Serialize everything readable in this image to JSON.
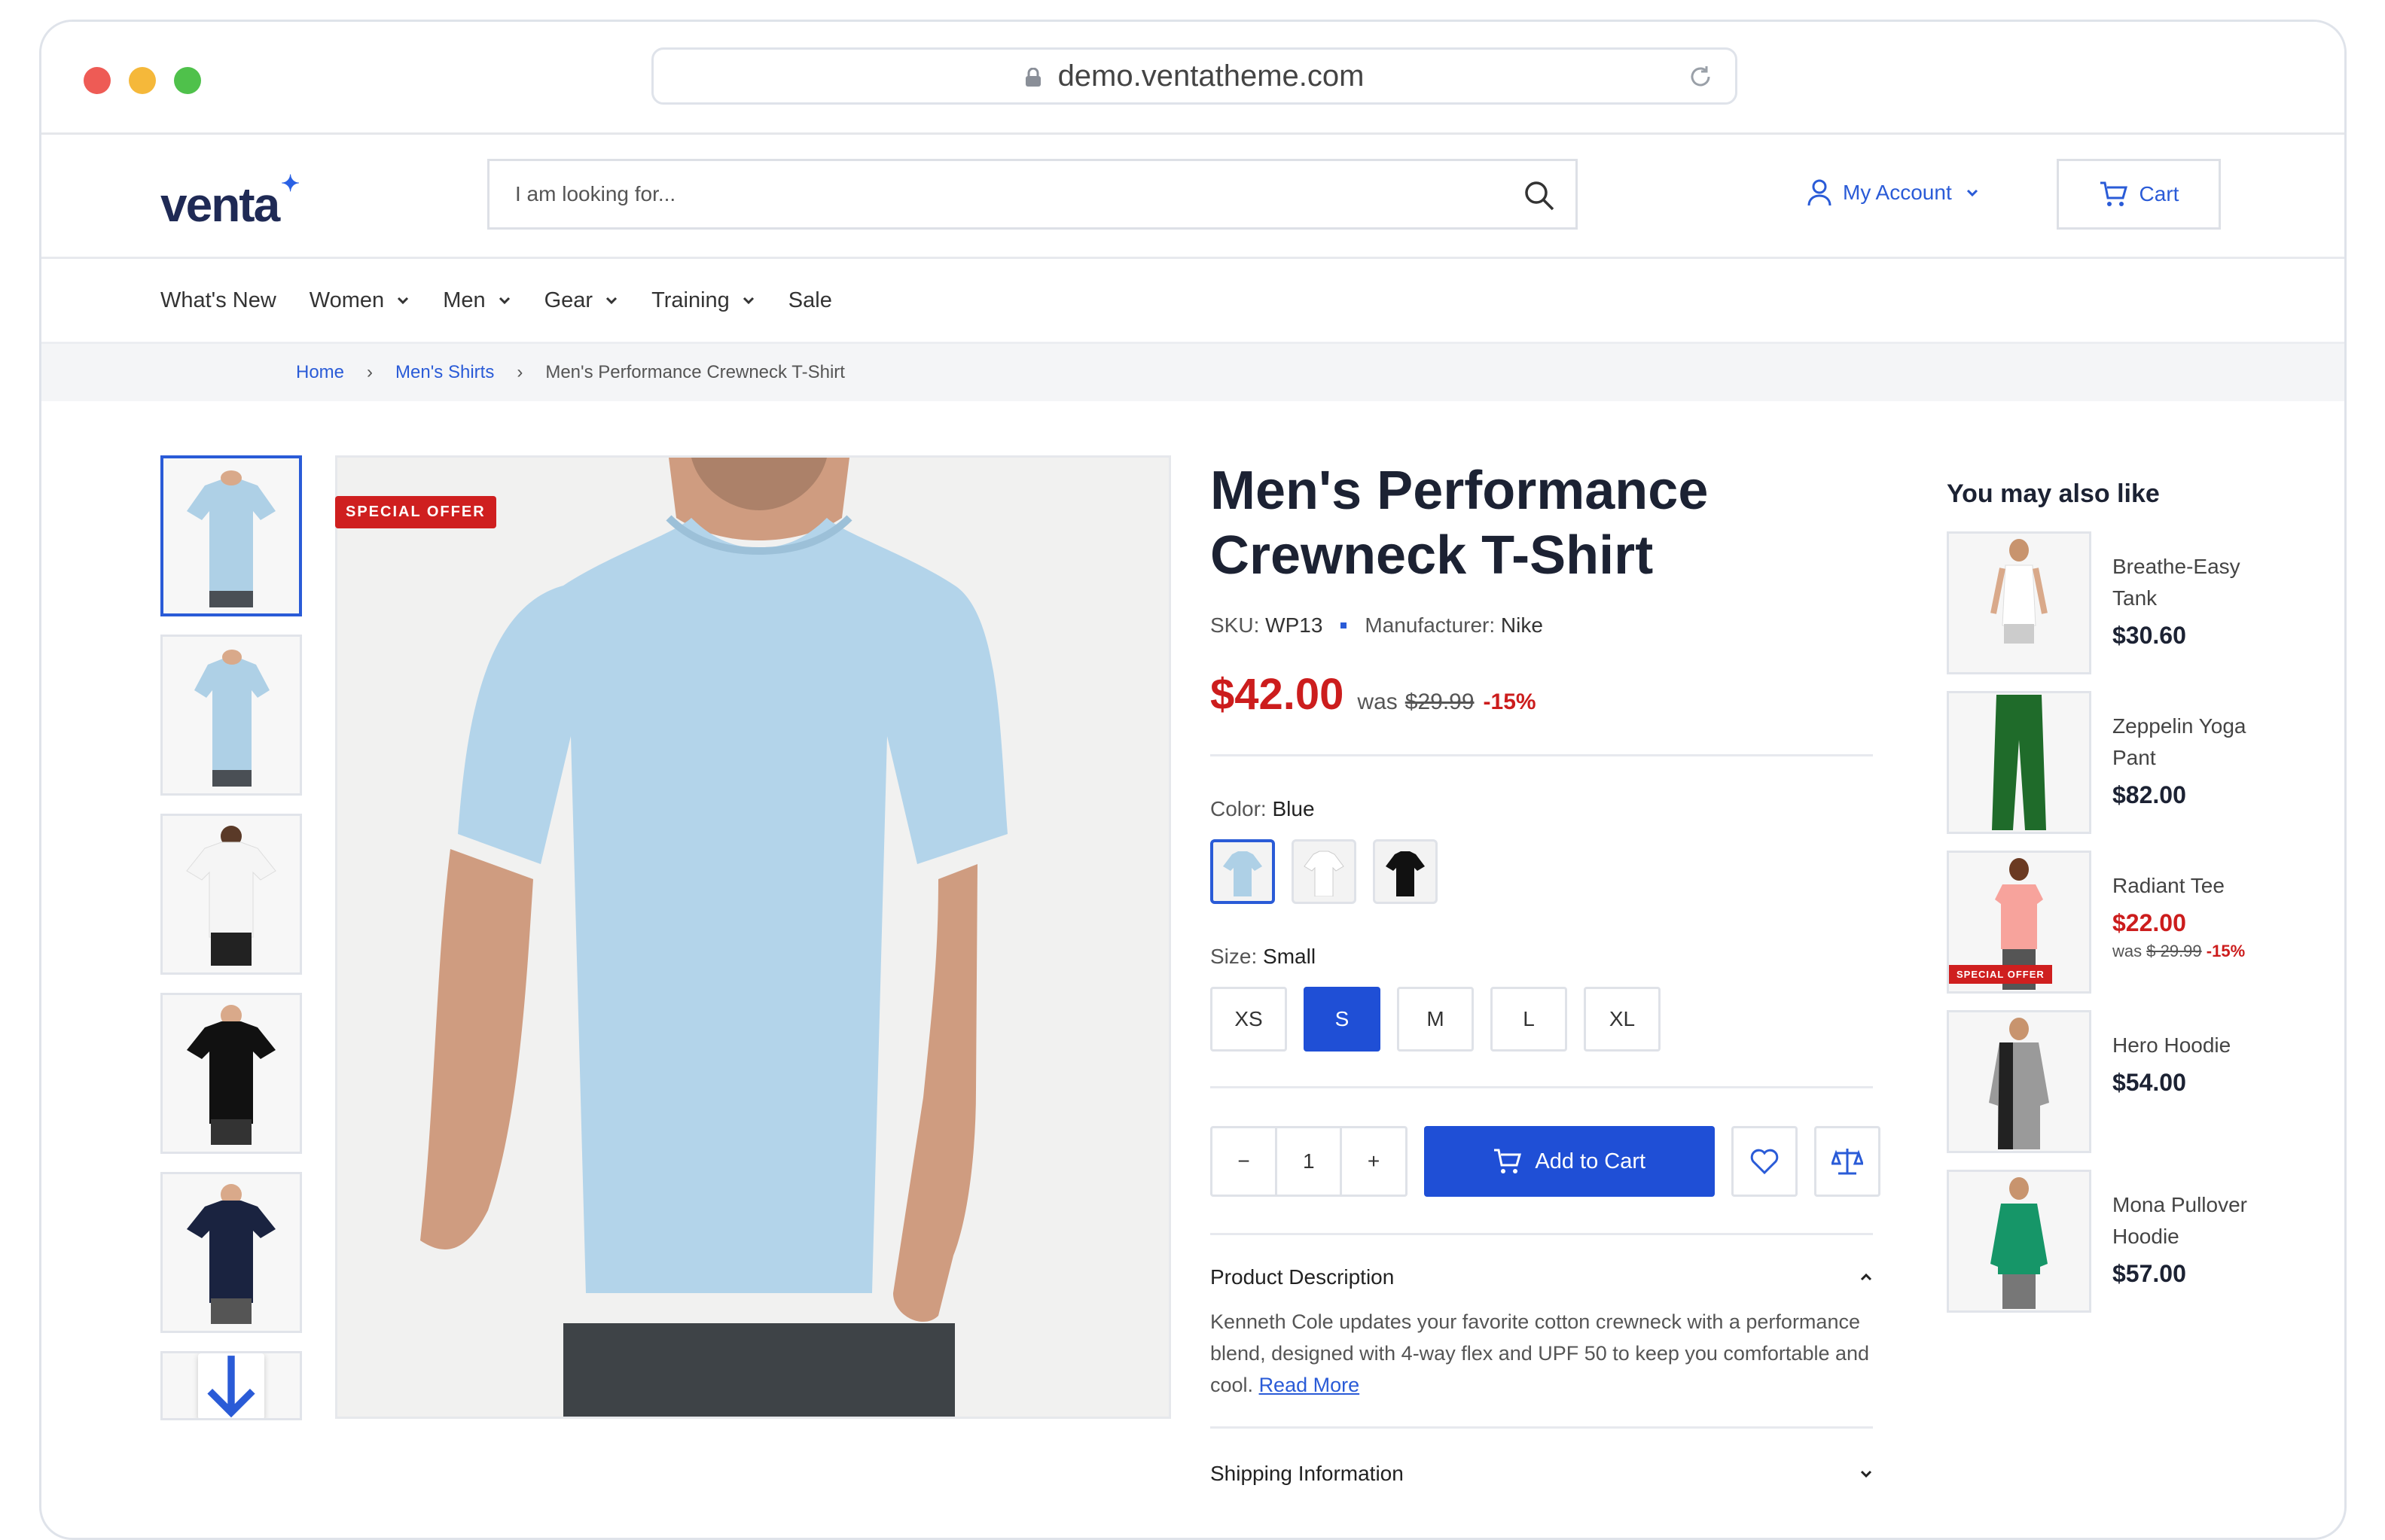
{
  "browser": {
    "url": "demo.ventatheme.com"
  },
  "brand": {
    "logo": "venta",
    "accent": "#1f4fd6",
    "sale_color": "#cc1d1d"
  },
  "header": {
    "search_placeholder": "I am looking for...",
    "account_label": "My Account",
    "cart_label": "Cart"
  },
  "nav": {
    "items": [
      "What's New",
      "Women",
      "Men",
      "Gear",
      "Training",
      "Sale"
    ]
  },
  "breadcrumb": {
    "home": "Home",
    "category": "Men's Shirts",
    "current": "Men's Performance Crewneck T-Shirt"
  },
  "gallery": {
    "badge": "SPECIAL OFFER"
  },
  "product": {
    "title_line1": "Men's Performance",
    "title_line2": "Crewneck T-Shirt",
    "sku_label": "SKU:",
    "sku": "WP13",
    "manufacturer_label": "Manufacturer:",
    "manufacturer": "Nike",
    "price": "$42.00",
    "was_label": "was",
    "old_price": "$29.99",
    "discount": "-15%",
    "color_label": "Color:",
    "color_value": "Blue",
    "size_label": "Size:",
    "size_value": "Small",
    "sizes": [
      "XS",
      "S",
      "M",
      "L",
      "XL"
    ],
    "quantity": "1",
    "qty_minus": "−",
    "qty_plus": "+",
    "add_to_cart": "Add to Cart",
    "description_title": "Product Description",
    "description": "Kenneth Cole updates your favorite cotton crewneck with a performance blend, designed with 4-way flex and UPF 50 to keep you comfortable and cool.",
    "read_more": "Read More",
    "shipping_title": "Shipping Information"
  },
  "recommendations": {
    "title": "You may also like",
    "items": [
      {
        "name": "Breathe-Easy Tank",
        "price": "$30.60"
      },
      {
        "name": "Zeppelin Yoga Pant",
        "price": "$82.00"
      },
      {
        "name": "Radiant Tee",
        "price": "$22.00",
        "was": "was",
        "old_price": "$ 29.99",
        "discount": "-15%",
        "badge": "SPECIAL OFFER"
      },
      {
        "name": "Hero Hoodie",
        "price": "$54.00"
      },
      {
        "name": "Mona Pullover Hoodie",
        "price": "$57.00"
      }
    ]
  }
}
